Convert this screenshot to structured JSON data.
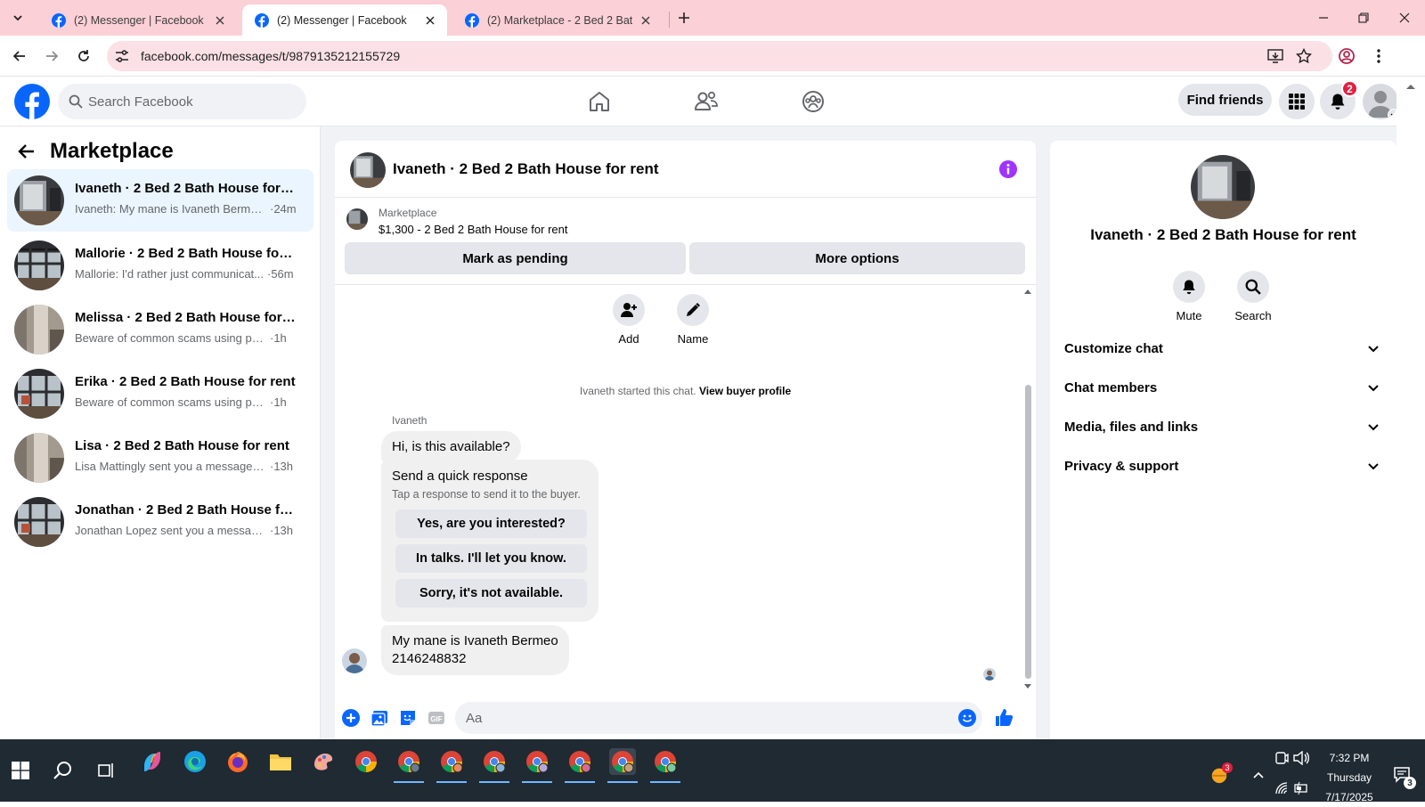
{
  "browser": {
    "tabs": [
      {
        "title": "(2) Messenger | Facebook"
      },
      {
        "title": "(2) Messenger | Facebook"
      },
      {
        "title": "(2) Marketplace - 2 Bed 2 Bath H"
      }
    ],
    "url": "facebook.com/messages/t/9879135212155729"
  },
  "header": {
    "search_placeholder": "Search Facebook",
    "find_friends": "Find friends",
    "notifications_count": "2"
  },
  "sidebar": {
    "title": "Marketplace",
    "chats": [
      {
        "name": "Ivaneth · 2 Bed 2 Bath House for r...",
        "preview": "Ivaneth: My mane is Ivaneth Berme...",
        "time": "·24m"
      },
      {
        "name": "Mallorie · 2 Bed 2 Bath House for r...",
        "preview": "Mallorie: I'd rather just communicat...",
        "time": "·56m"
      },
      {
        "name": "Melissa · 2 Bed 2 Bath House for r...",
        "preview": "Beware of common scams using pay...",
        "time": "·1h"
      },
      {
        "name": "Erika · 2 Bed 2 Bath House for rent",
        "preview": "Beware of common scams using pay...",
        "time": "·1h"
      },
      {
        "name": "Lisa · 2 Bed 2 Bath House for rent",
        "preview": "Lisa Mattingly sent you a message a...",
        "time": "·13h"
      },
      {
        "name": "Jonathan · 2 Bed 2 Bath House for ...",
        "preview": "Jonathan Lopez sent you a message ...",
        "time": "·13h"
      }
    ]
  },
  "conversation": {
    "title": "Ivaneth · 2 Bed 2 Bath House for rent",
    "marketplace_label": "Marketplace",
    "listing": "$1,300 - 2 Bed 2 Bath House for rent",
    "mark_pending": "Mark as pending",
    "more_options": "More options",
    "actions": {
      "add": "Add",
      "name": "Name"
    },
    "started_text": "Ivaneth started this chat.",
    "view_profile": "View buyer profile",
    "sender": "Ivaneth",
    "msg1": "Hi, is this available?",
    "quick_title": "Send a quick response",
    "quick_sub": "Tap a response to send it to the buyer.",
    "quick_replies": [
      "Yes, are you interested?",
      "In talks. I'll let you know.",
      "Sorry, it's not available."
    ],
    "msg2_line1": "My mane is Ivaneth Bermeo",
    "msg2_line2": "2146248832",
    "composer_placeholder": "Aa"
  },
  "details": {
    "name": "Ivaneth · 2 Bed 2 Bath House for rent",
    "mute": "Mute",
    "search": "Search",
    "sections": [
      "Customize chat",
      "Chat members",
      "Media, files and links",
      "Privacy & support"
    ]
  },
  "taskbar": {
    "time": "7:32 PM",
    "day": "Thursday",
    "date": "7/17/2025",
    "weather_badge": "3",
    "notif_badge": "3"
  },
  "colors": {
    "facebook_blue": "#0866ff",
    "messenger_purple": "#a033ff",
    "tab_strip": "#fbd0d6",
    "selected_chat": "#ebf5ff"
  }
}
